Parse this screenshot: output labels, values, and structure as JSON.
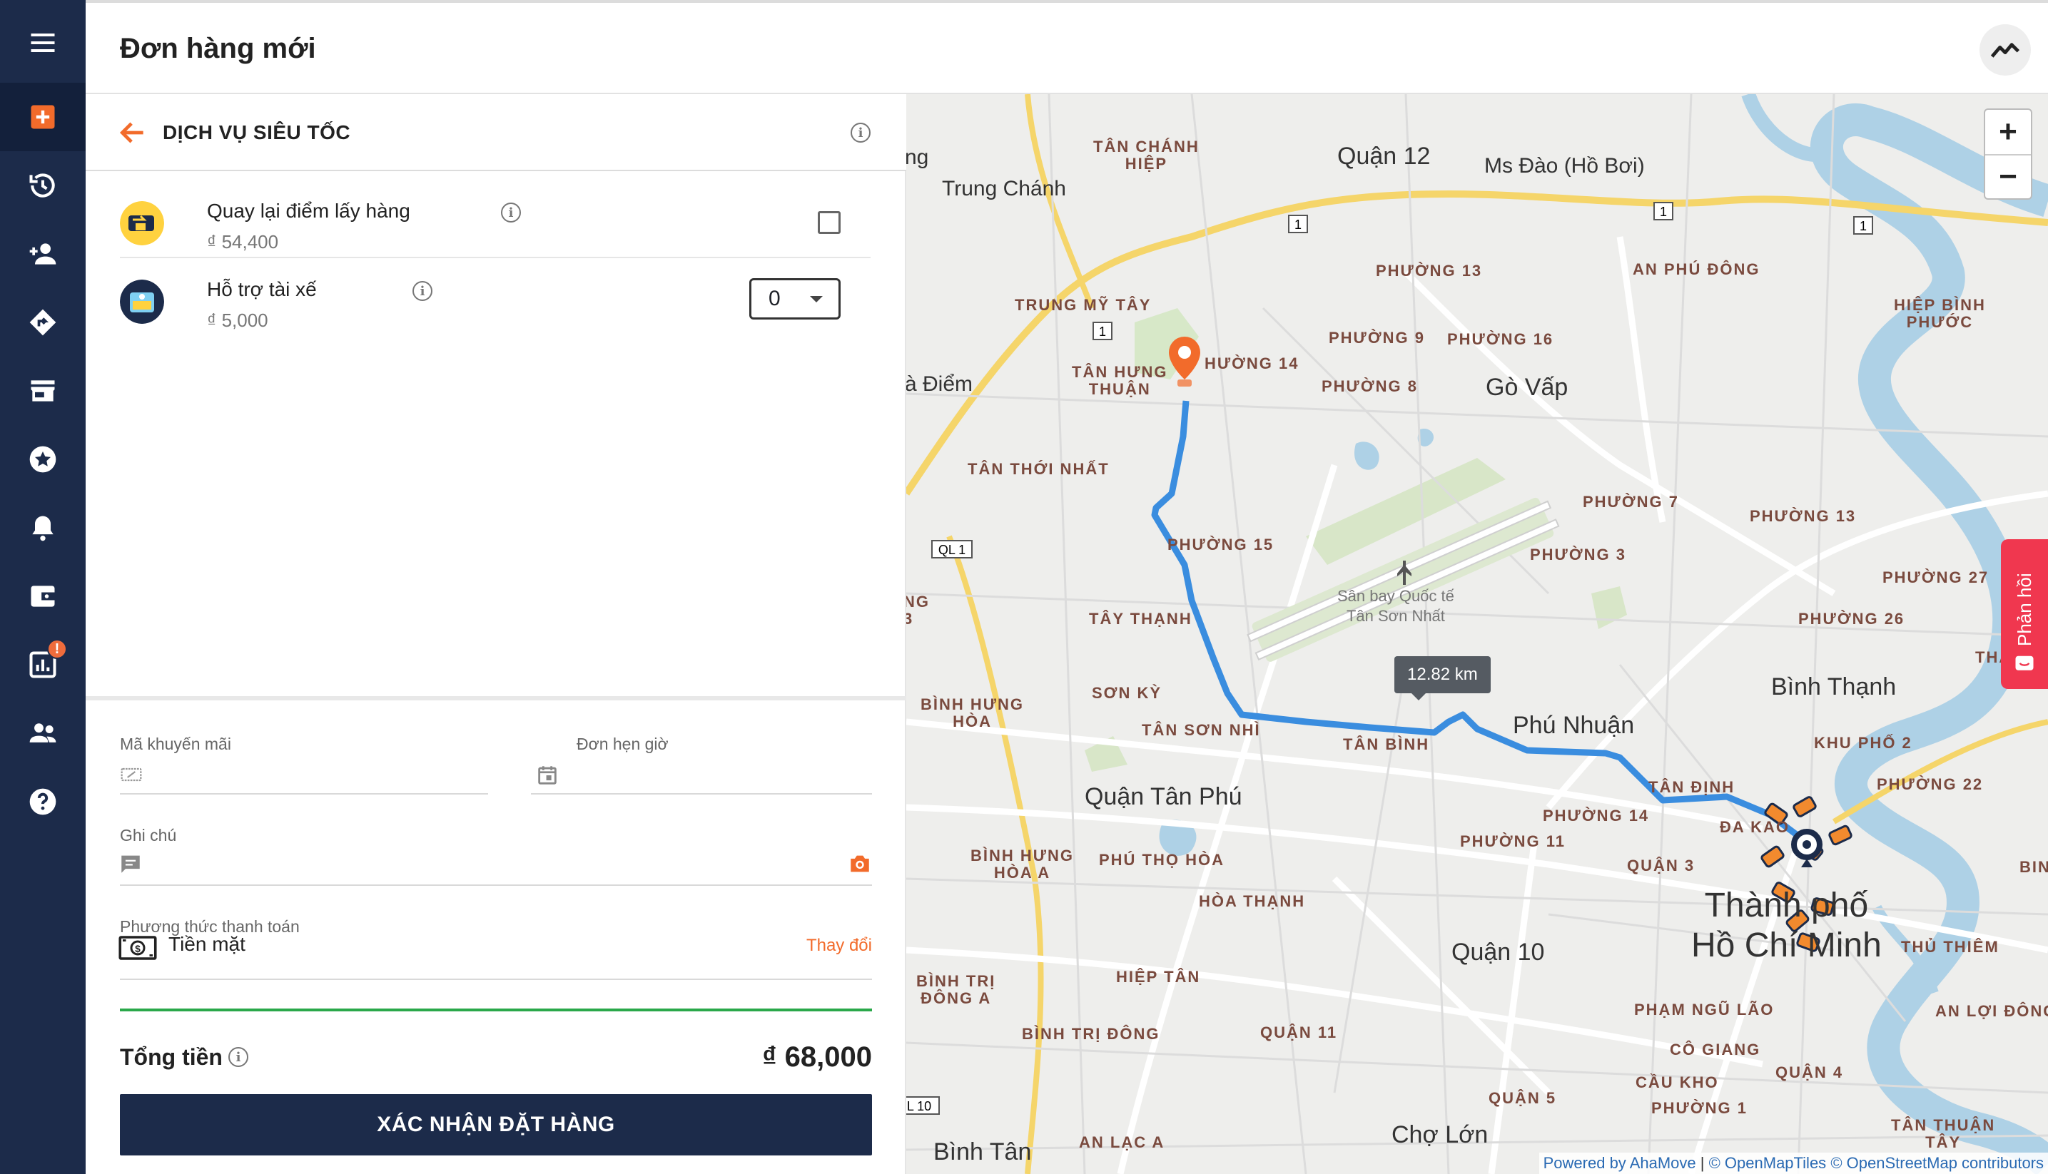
{
  "header": {
    "title": "Đơn hàng mới"
  },
  "sidebar": {
    "items": [
      {
        "name": "menu-icon"
      },
      {
        "name": "new-order-icon"
      },
      {
        "name": "history-icon"
      },
      {
        "name": "add-user-icon"
      },
      {
        "name": "directions-icon"
      },
      {
        "name": "store-icon"
      },
      {
        "name": "star-icon"
      },
      {
        "name": "bell-icon"
      },
      {
        "name": "wallet-icon"
      },
      {
        "name": "report-icon",
        "badge": "!"
      },
      {
        "name": "group-icon"
      },
      {
        "name": "help-icon"
      }
    ]
  },
  "service": {
    "name": "DỊCH VỤ SIÊU TỐC"
  },
  "options": [
    {
      "title": "Quay lại điểm lấy hàng",
      "price": "₫ 54,400",
      "checked": false
    },
    {
      "title": "Hỗ trợ tài xế",
      "price": "₫ 5,000",
      "quantity": "0"
    }
  ],
  "form": {
    "promo_label": "Mã khuyến mãi",
    "schedule_label": "Đơn hẹn giờ",
    "note_label": "Ghi chú",
    "payment_label": "Phương thức thanh toán",
    "payment_method": "Tiền mặt",
    "change_label": "Thay đổi",
    "total_label": "Tổng tiền",
    "total_value": "₫ 68,000",
    "confirm_label": "XÁC NHẬN ĐẶT HÀNG"
  },
  "map": {
    "distance": "12.82 km",
    "zoom_in": "+",
    "zoom_out": "−",
    "feedback": "Phản hồi",
    "attribution": {
      "powered": "Powered by AhaMove",
      "tiles": "© OpenMapTiles",
      "osm": "© OpenStreetMap contributors"
    },
    "road_shields": [
      "1",
      "1",
      "1",
      "1",
      "QL 1",
      "L 10"
    ],
    "districts": [
      "Quận 12",
      "Ms Đào (Hồ Bơi)",
      "Trung Chánh",
      "à Điểm",
      "Gò Vấp",
      "Phú Nhuận",
      "Bình Thạnh",
      "Quận Tân Phú",
      "Quận 10",
      "Chợ Lớn",
      "Bình Tân",
      "ng"
    ],
    "city": [
      "Thành phố",
      "Hồ Chí Minh"
    ],
    "airport": [
      "Sân bay Quốc tế",
      "Tân Sơn Nhất"
    ],
    "wards": [
      "TÂN CHÁNH\nHIỆP",
      "PHƯỜNG 13",
      "AN PHÚ ĐÔNG",
      "HIỆP BÌNH\nPHƯỚC",
      "TRUNG MỸ TÂY",
      "PHƯỜNG 9",
      "PHƯỜNG 16",
      "HƯỜNG 14",
      "TÂN HƯNG\nTHUẬN",
      "PHƯỜNG 8",
      "TÂN THỚI NHẤT",
      "PHƯỜNG 7",
      "PHƯỜNG 13",
      "PHƯỜNG 15",
      "PHƯỜNG 3",
      "PHƯỜNG 27",
      "TÂY THẠNH",
      "PHƯỜNG 26",
      "SƠN KỲ",
      "BÌNH HƯNG\nHÒA",
      "TÂN SƠN NHÌ",
      "TÂN BÌNH",
      "KHU PHỐ 2",
      "TÂN ĐỊNH",
      "PHƯỜNG 22",
      "ĐA KAO",
      "PHƯỜNG 14",
      "PHƯỜNG 11",
      "BÌNH HƯNG\nHÒA A",
      "PHÚ THỌ HÒA",
      "QUẬN 3",
      "HÒA THẠNH",
      "THỦ THIÊM",
      "BÌNH TRỊ\nĐÔNG A",
      "HIỆP TÂN",
      "PHẠM NGŨ LÃO",
      "AN LỢI ĐÔNG",
      "BÌNH TRỊ ĐÔNG",
      "QUẬN 11",
      "CÔ GIANG",
      "QUẬN 4",
      "CẦU KHO",
      "PHƯỜNG 1",
      "QUẬN 5",
      "AN LẠC A",
      "TÂN THUẬN\nTÂY",
      "NG\n3",
      "THẢ",
      "BIN"
    ]
  }
}
